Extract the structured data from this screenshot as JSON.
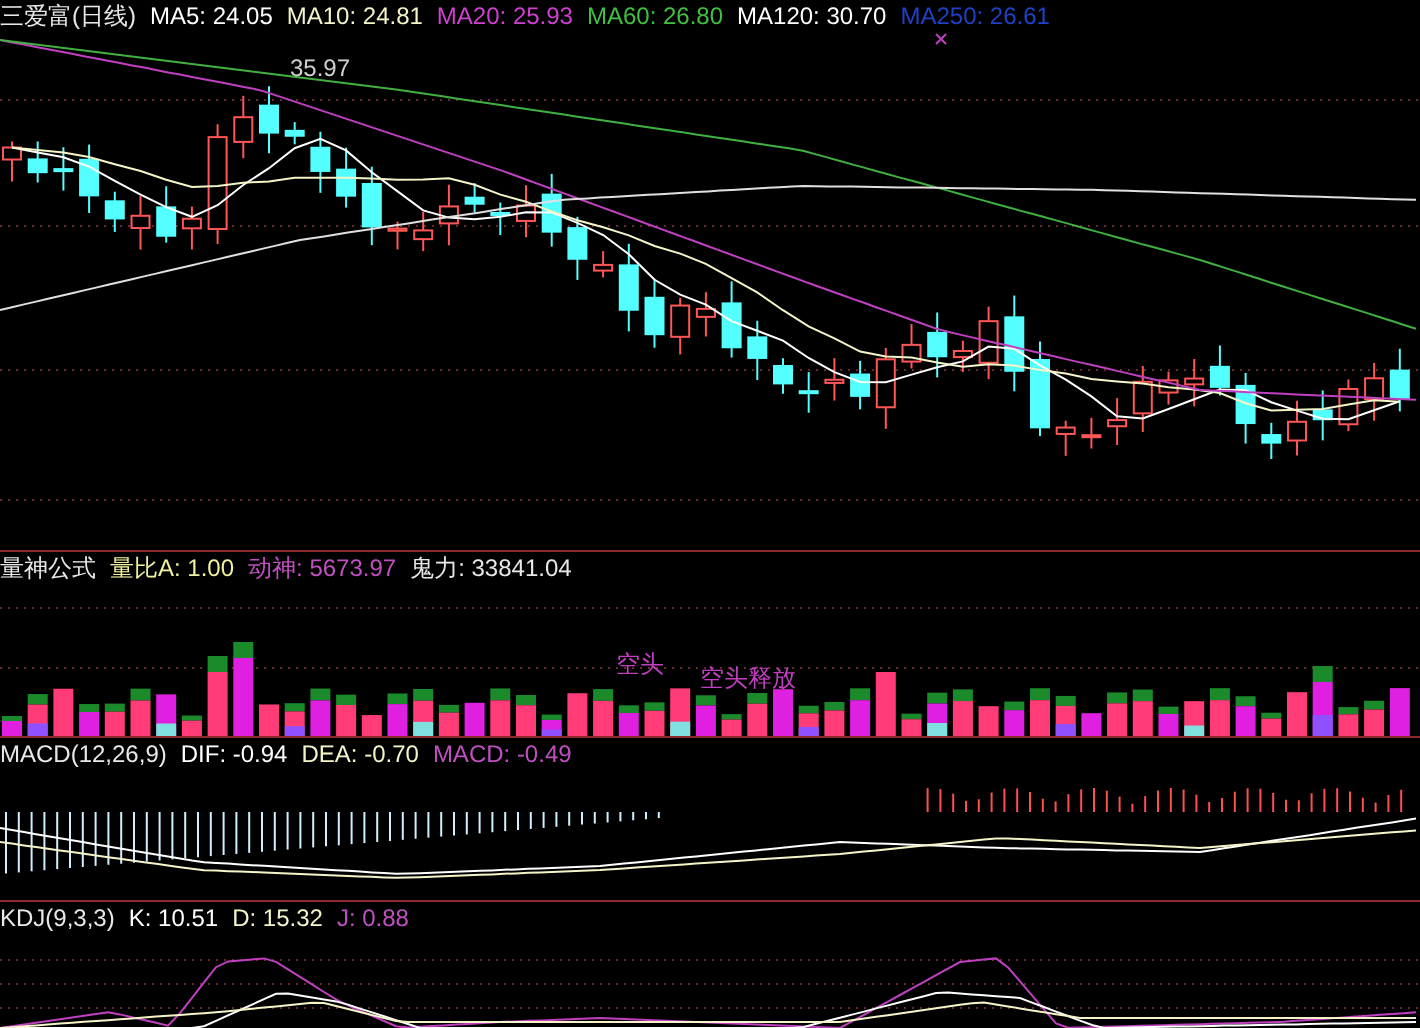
{
  "price_panel": {
    "legend": [
      {
        "text": "三爱富(日线)",
        "color": "#e8e8e8"
      },
      {
        "text": "MA5: 24.05",
        "color": "#ffffff"
      },
      {
        "text": "MA10: 24.81",
        "color": "#f4f4c8"
      },
      {
        "text": "MA20: 25.93",
        "color": "#d040d0"
      },
      {
        "text": "MA60: 26.80",
        "color": "#40c040"
      },
      {
        "text": "MA120: 30.70",
        "color": "#ffffff"
      },
      {
        "text": "MA250: 26.61",
        "color": "#2040c8"
      }
    ],
    "peak_label": "35.97"
  },
  "volume_panel": {
    "legend": [
      {
        "text": "量神公式",
        "color": "#e8e8e8"
      },
      {
        "text": "量比A: 1.00",
        "color": "#f0f0a0"
      },
      {
        "text": "动神: 5673.97",
        "color": "#c050c0"
      },
      {
        "text": "鬼力: 33841.04",
        "color": "#e8e8e8"
      }
    ],
    "annotations": [
      "空头",
      "空头释放"
    ]
  },
  "macd_panel": {
    "legend": [
      {
        "text": "MACD(12,26,9)",
        "color": "#e8e8e8"
      },
      {
        "text": "DIF: -0.94",
        "color": "#ffffff"
      },
      {
        "text": "DEA: -0.70",
        "color": "#f4f4c8"
      },
      {
        "text": "MACD: -0.49",
        "color": "#c050c0"
      }
    ]
  },
  "kdj_panel": {
    "legend": [
      {
        "text": "KDJ(9,3,3)",
        "color": "#e8e8e8"
      },
      {
        "text": "K: 10.51",
        "color": "#ffffff"
      },
      {
        "text": "D: 15.32",
        "color": "#f4f4c8"
      },
      {
        "text": "J: 0.88",
        "color": "#c050c0"
      }
    ]
  }
}
